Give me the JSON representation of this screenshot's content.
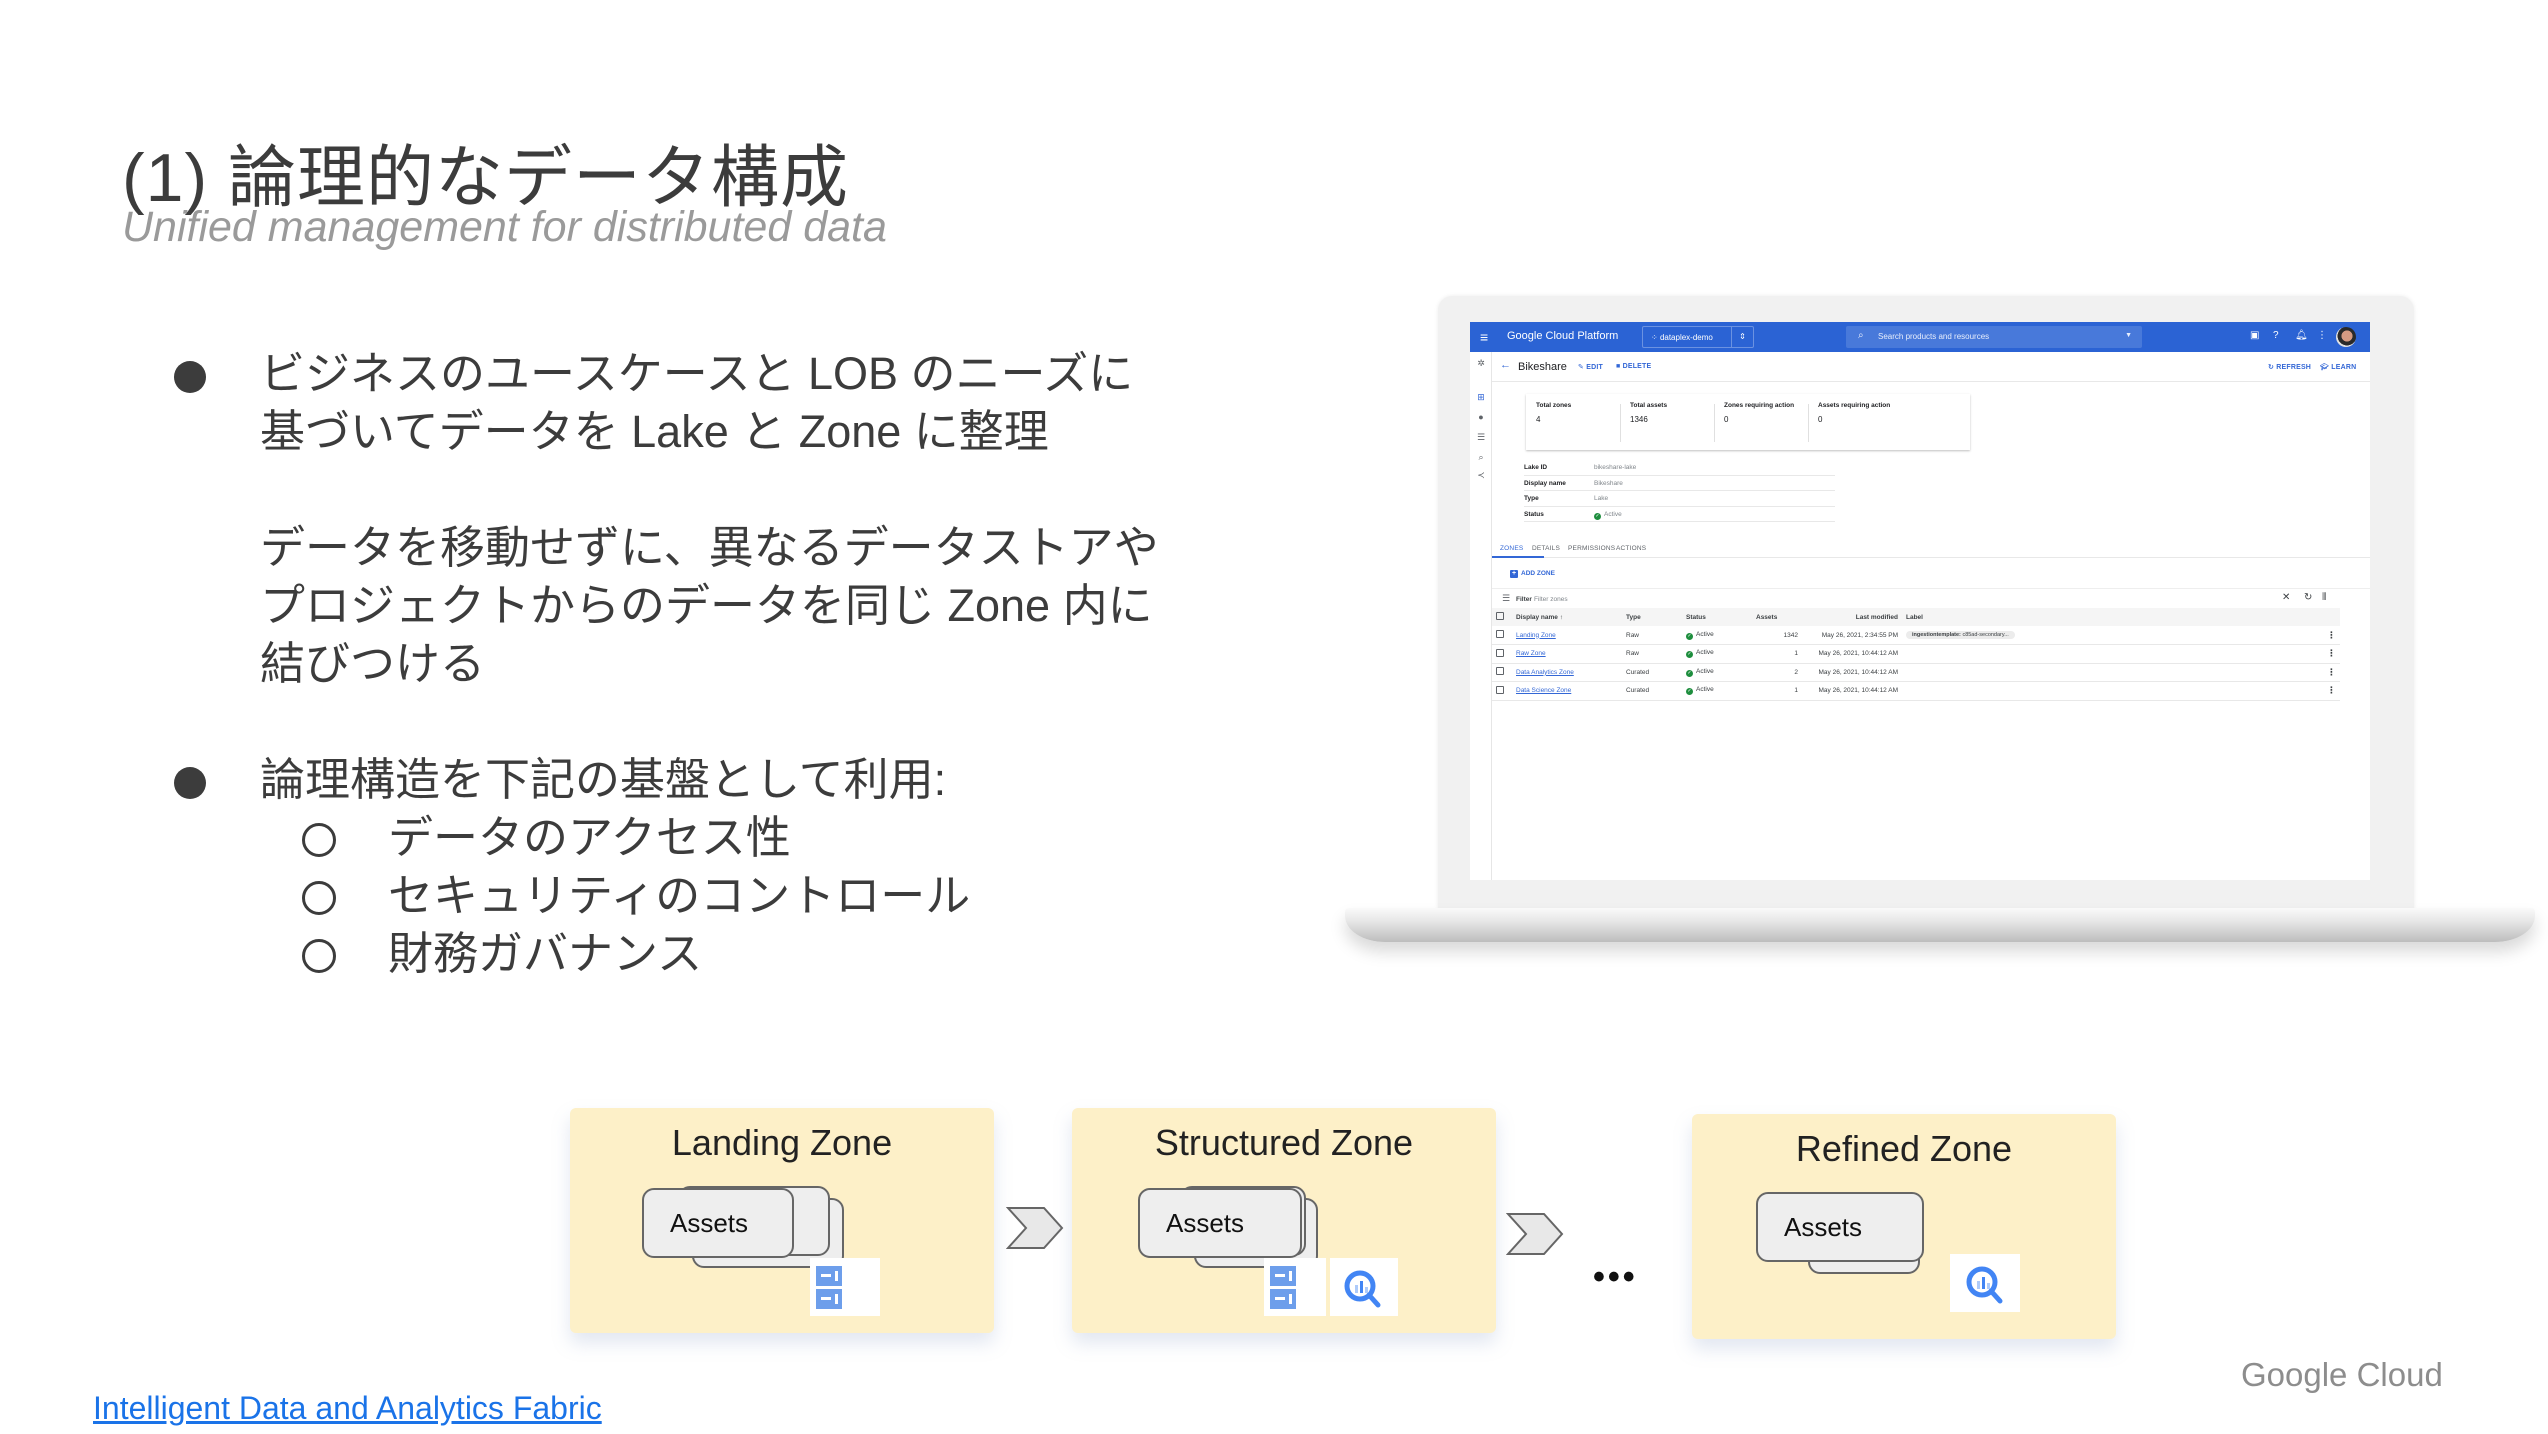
{
  "slide": {
    "title": "(1) 論理的なデータ構成",
    "subtitle": "Unified management for distributed data",
    "bullets": [
      {
        "lines": [
          "ビジネスのユースケースと LOB のニーズに",
          "基づいてデータを Lake と Zone に整理"
        ],
        "extra_lines": [
          "データを移動せずに、異なるデータストアや",
          "プロジェクトからのデータを同じ Zone 内に",
          "結びつける"
        ]
      },
      {
        "lines": [
          "論理構造を下記の基盤として利用:"
        ],
        "sub_items": [
          "データのアクセス性",
          "セキュリティのコントロール",
          "財務ガバナンス"
        ]
      }
    ],
    "footer_link": "Intelligent Data and Analytics Fabric",
    "logo_text": "Google Cloud"
  },
  "console": {
    "app_name": "Google Cloud Platform",
    "project": "dataplex-demo",
    "search_placeholder": "Search products and resources",
    "page_title": "Bikeshare",
    "actions": {
      "edit": "EDIT",
      "delete": "DELETE",
      "refresh": "REFRESH",
      "learn": "LEARN"
    },
    "stats": [
      {
        "label": "Total zones",
        "value": "4"
      },
      {
        "label": "Total assets",
        "value": "1346"
      },
      {
        "label": "Zones requiring action",
        "value": "0"
      },
      {
        "label": "Assets requiring action",
        "value": "0"
      }
    ],
    "properties": [
      {
        "key": "Lake ID",
        "value": "bikeshare-lake"
      },
      {
        "key": "Display name",
        "value": "Bikeshare"
      },
      {
        "key": "Type",
        "value": "Lake"
      },
      {
        "key": "Status",
        "value": "Active"
      }
    ],
    "tabs": [
      "ZONES",
      "DETAILS",
      "PERMISSIONS",
      "ACTIONS"
    ],
    "active_tab": "ZONES",
    "add_zone": "ADD ZONE",
    "filter_label": "Filter",
    "filter_placeholder": "Filter zones",
    "table": {
      "headers": [
        "Display name",
        "Type",
        "Status",
        "Assets",
        "Last modified",
        "Label"
      ],
      "rows": [
        {
          "name": "Landing Zone",
          "type": "Raw",
          "status": "Active",
          "assets": "1342",
          "modified": "May 26, 2021, 2:34:55 PM",
          "label_key": "ingestiontemplate:",
          "label_value": "c85ad-secondary..."
        },
        {
          "name": "Raw Zone",
          "type": "Raw",
          "status": "Active",
          "assets": "1",
          "modified": "May 26, 2021, 10:44:12 AM",
          "label_key": "",
          "label_value": ""
        },
        {
          "name": "Data Analytics Zone",
          "type": "Curated",
          "status": "Active",
          "assets": "2",
          "modified": "May 26, 2021, 10:44:12 AM",
          "label_key": "",
          "label_value": ""
        },
        {
          "name": "Data Science Zone",
          "type": "Curated",
          "status": "Active",
          "assets": "1",
          "modified": "May 26, 2021, 10:44:12 AM",
          "label_key": "",
          "label_value": ""
        }
      ]
    },
    "colors": {
      "header_bar": "#2b63d4",
      "accent": "#3367d6",
      "active_green": "#1e8e3e"
    }
  },
  "diagram": {
    "zones": [
      {
        "title": "Landing Zone",
        "asset_label": "Assets",
        "services": [
          "cloud-storage-icon"
        ]
      },
      {
        "title": "Structured Zone",
        "asset_label": "Assets",
        "services": [
          "cloud-storage-icon",
          "bigquery-icon"
        ]
      },
      {
        "title": "Refined Zone",
        "asset_label": "Assets",
        "services": [
          "bigquery-icon"
        ]
      }
    ],
    "ellipsis": "•••",
    "colors": {
      "zone_fill": "#fdf0c8",
      "storage_blue": "#6d9eeb",
      "bigquery_blue": "#4285f4"
    }
  }
}
